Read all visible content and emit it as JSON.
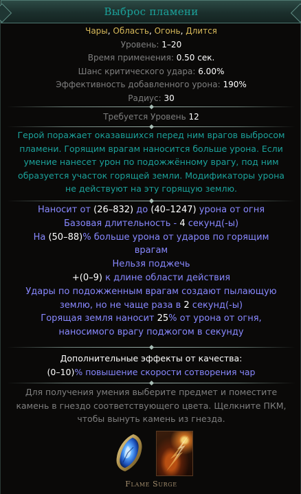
{
  "tooltip": {
    "title": "Выброс пламени",
    "tags": {
      "t1": "Чары",
      "s1": ", ",
      "t2": "Область",
      "s2": ", ",
      "t3": "Огонь",
      "s3": ", ",
      "t4": "Длится"
    },
    "properties": {
      "level_label": "Уровень: ",
      "level_value": "1–20",
      "cast_time_label": "Время применения: ",
      "cast_time_value": "0.50 сек.",
      "crit_label": "Шанс критического удара: ",
      "crit_value": "6.00%",
      "effectiveness_label": "Эффективность добавленного урона: ",
      "effectiveness_value": "190%",
      "radius_label": "Радиус: ",
      "radius_value": "30"
    },
    "requirements": {
      "label": "Требуется Уровень ",
      "value": "12"
    },
    "description": [
      "Герой поражает оказавшихся перед ним врагов выбросом",
      "пламени. Горящим врагам наносится больше урона. Если",
      "умение нанесет урон по подожжённому врагу, под ним",
      "образуется участок горящей земли. Модификаторы урона",
      "не действуют на эту горящую землю."
    ],
    "mods": {
      "m1a": "Наносит от ",
      "m1b": "(26–832)",
      "m1c": " до ",
      "m1d": "(40–1247)",
      "m1e": " урона от огня",
      "m2a": "Базовая длительность - ",
      "m2b": "4",
      "m2c": " секунд(-ы)",
      "m3a": "На ",
      "m3b": "(50–88)",
      "m3c": "% больше урона от ударов по горящим",
      "m3d": "врагам",
      "m4": "Нельзя поджечь",
      "m5a": "+(0–9)",
      "m5b": " к длине области действия",
      "m6a": "Удары по подожженным врагам создают пылающую",
      "m6b": "землю, но не чаще раза в ",
      "m6c": "2",
      "m6d": " секунд(-ы)",
      "m7a": "Горящая земля наносит ",
      "m7b": "25",
      "m7c": "% от урона от огня,",
      "m7d": "наносимого врагу поджогом в секунду"
    },
    "quality": {
      "label": "Дополнительные эффекты от качества:",
      "value": "(0–10)",
      "text": "% повышение скорости сотворения чар"
    },
    "help": [
      "Для получения умения выберите предмет и поместите",
      "камень в гнездо соответствующего цвета. Щелкните ПКМ,",
      "чтобы вынуть камень из гнезда."
    ],
    "skill_name": "Flame Surge",
    "icons": {
      "gem": "blue-skill-gem-icon",
      "skill": "flame-surge-skill-icon"
    }
  },
  "colors": {
    "title": "#1ba29b",
    "tags": "#d7b95a",
    "property_label": "#7f7f7f",
    "value": "#ffffff",
    "description": "#1ba29b",
    "mod": "#8888ff",
    "help": "#7f7f7f",
    "skill_name": "#a38d6d"
  }
}
